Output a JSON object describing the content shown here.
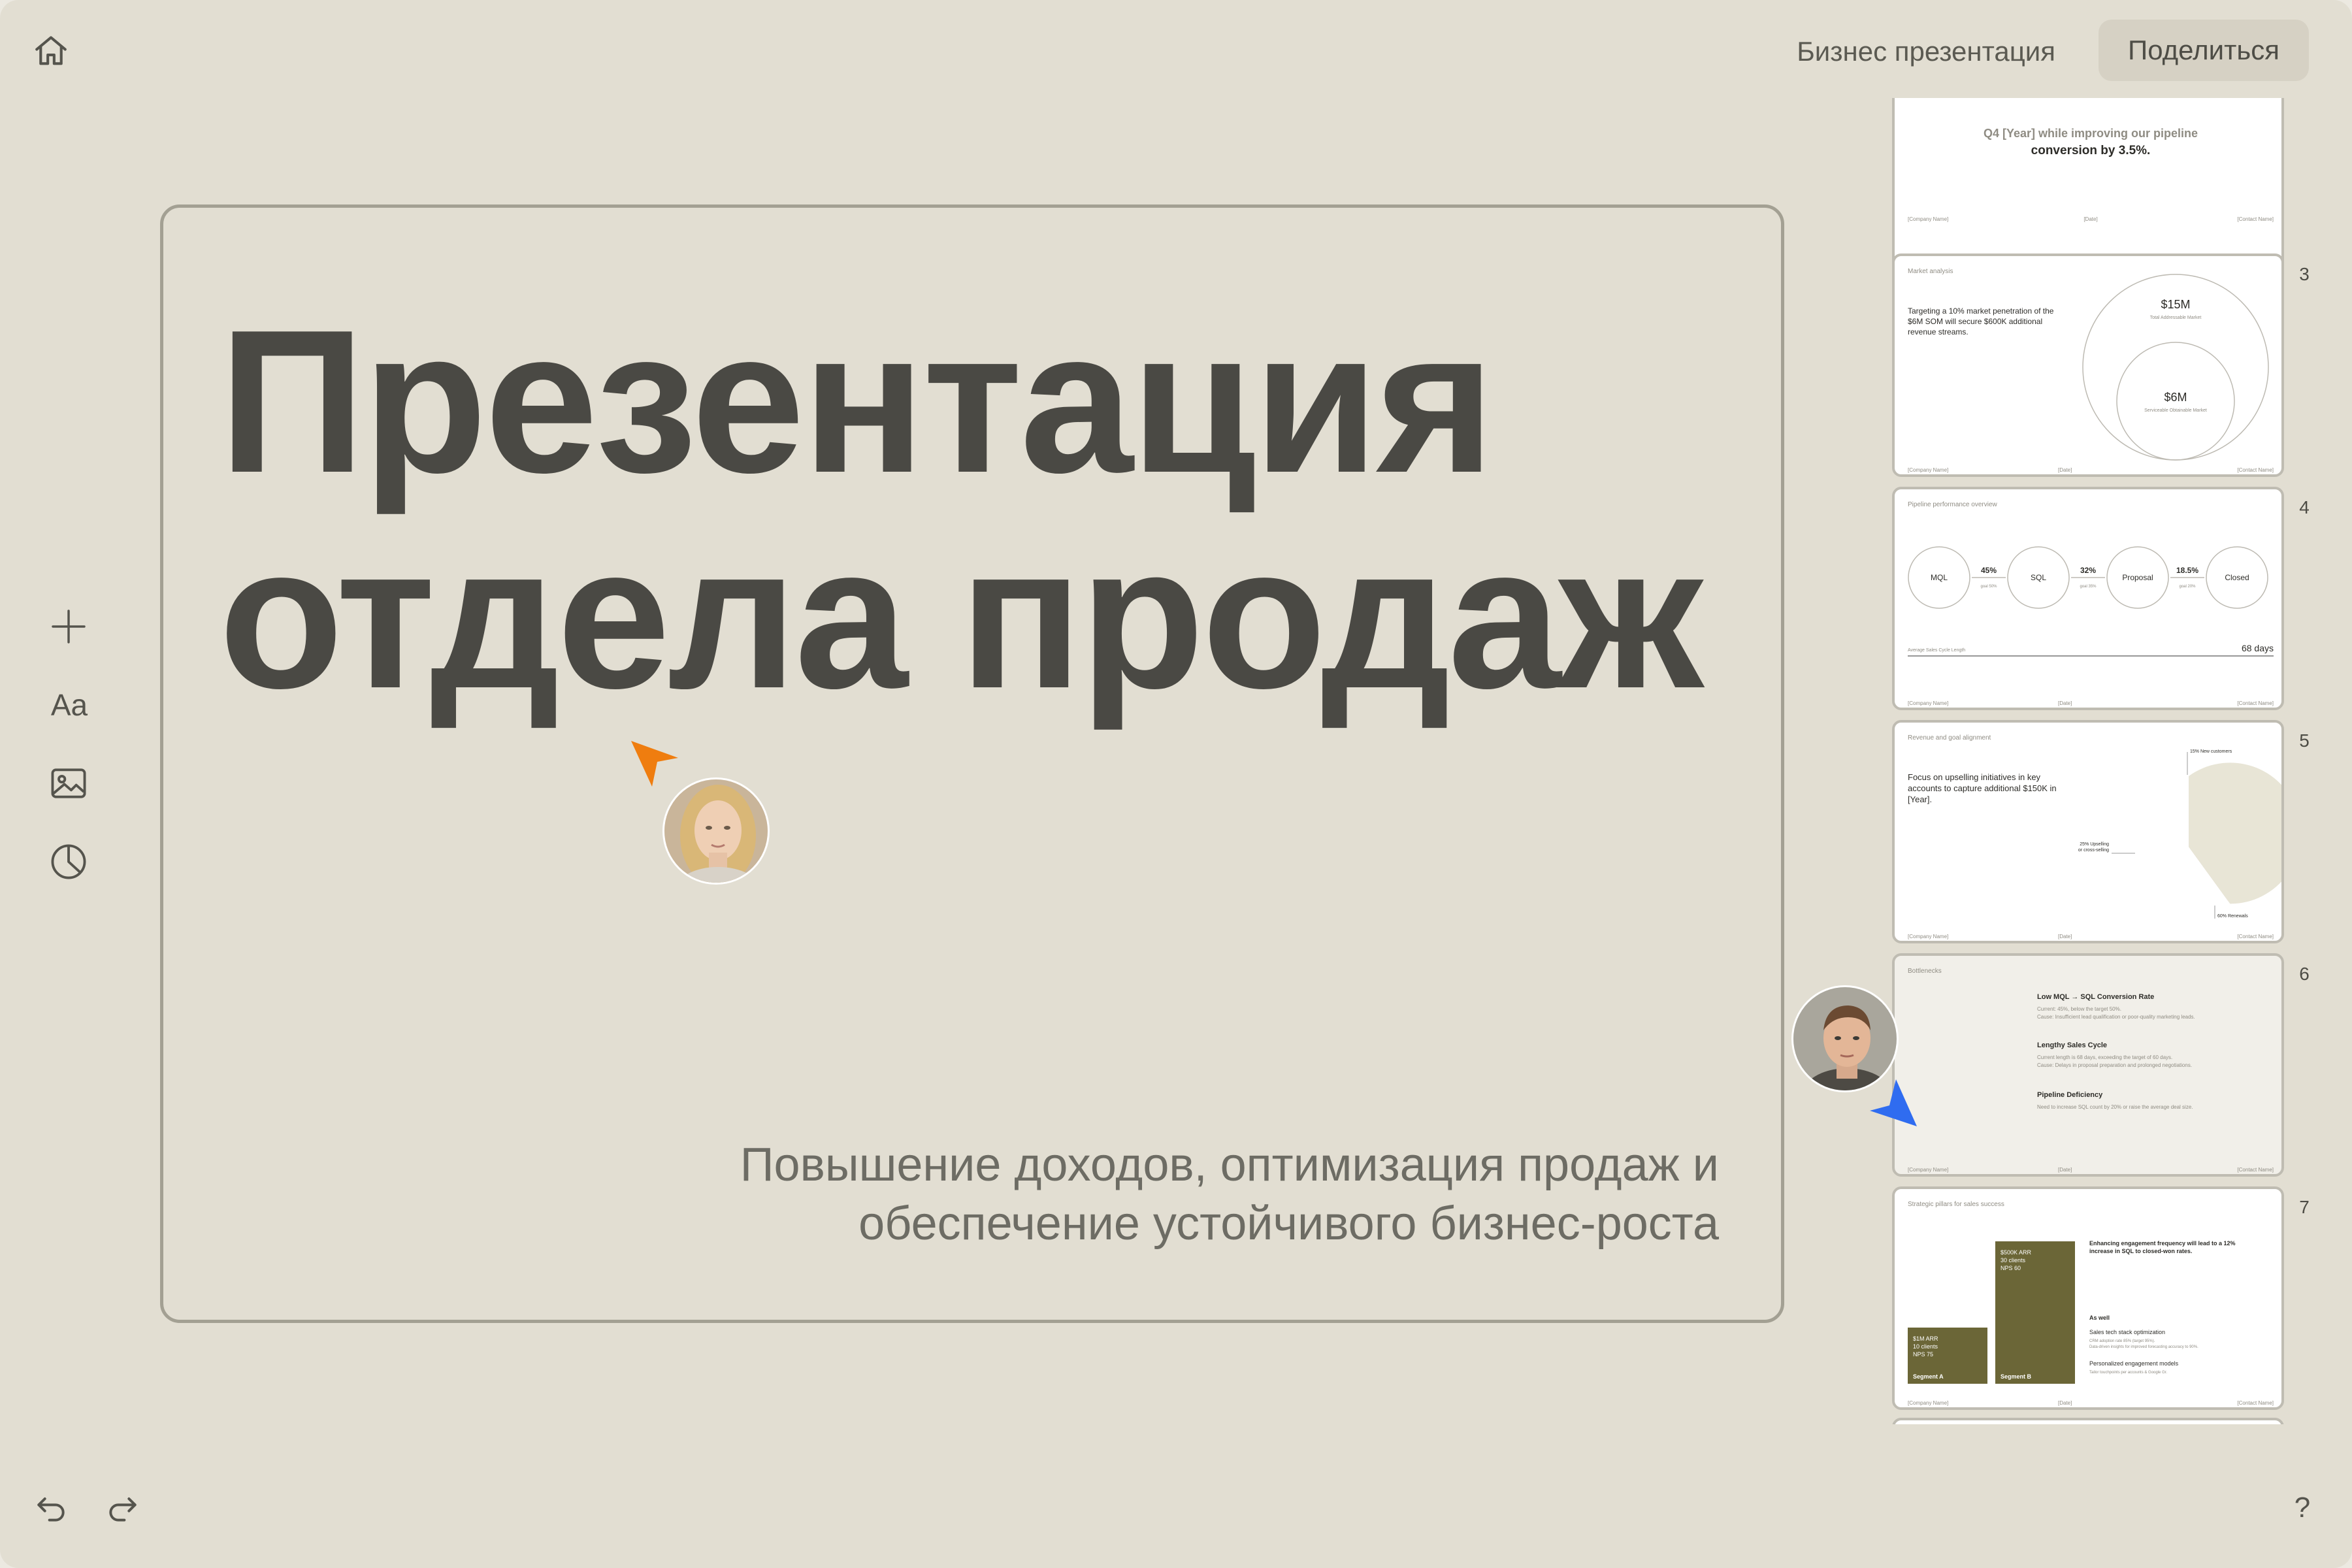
{
  "header": {
    "doc_title": "Бизнес презентация",
    "share_label": "Поделиться"
  },
  "icons": {
    "home": "home-icon",
    "add": "plus-icon",
    "text_tool": "Aa",
    "image": "image-icon",
    "chart": "pie-chart-icon",
    "undo": "undo-icon",
    "redo": "redo-icon",
    "help": "?"
  },
  "main_slide": {
    "title_line1": "Презентация",
    "title_line2": "отдела продаж",
    "subtitle_line1": "Повышение доходов, оптимизация продаж и",
    "subtitle_line2": "обеспечение устойчивого бизнес-роста"
  },
  "colors": {
    "cursor_a": "#ef7d0f",
    "cursor_b": "#2f6cf0",
    "bar": "#6b6637",
    "pie_a": "#c4a372",
    "pie_b": "#cdc4b5",
    "pie_c": "#e8e5d6"
  },
  "thumbnails": [
    {
      "number": "",
      "text1": "Q4 [Year] while improving our pipeline",
      "text2": "conversion by 3.5%.",
      "footer_left": "[Company Name]",
      "footer_mid": "[Date]",
      "footer_right": "[Contact Name]"
    },
    {
      "number": "3",
      "header": "Market analysis",
      "body1": "Targeting a 10% market penetration of the",
      "body2": "$6M SOM will secure $600K additional",
      "body3": "revenue streams.",
      "big_value": "$15M",
      "big_label": "Total Addressable Market",
      "small_value": "$6M",
      "small_label": "Serviceable Obtainable Market",
      "footer_left": "[Company Name]",
      "footer_mid": "[Date]",
      "footer_right": "[Contact Name]"
    },
    {
      "number": "4",
      "header": "Pipeline performance overview",
      "stages": [
        {
          "label": "MQL"
        },
        {
          "label": "SQL"
        },
        {
          "label": "Proposal"
        },
        {
          "label": "Closed"
        }
      ],
      "conversions": [
        {
          "pct": "45%",
          "goal": "goal 50%"
        },
        {
          "pct": "32%",
          "goal": "goal 35%"
        },
        {
          "pct": "18.5%",
          "goal": "goal 20%"
        }
      ],
      "cycle_label": "Average Sales Cycle Length",
      "cycle_value": "68 days",
      "footer_left": "[Company Name]",
      "footer_mid": "[Date]",
      "footer_right": "[Contact Name]"
    },
    {
      "number": "5",
      "header": "Revenue and goal alignment",
      "body1": "Focus on upselling initiatives in key",
      "body2": "accounts to capture additional $150K in",
      "body3": "[Year].",
      "pie_label_a": "15% New customers",
      "pie_label_b1": "25% Upselling",
      "pie_label_b2": "or cross-selling",
      "pie_label_c": "60% Renewals",
      "pie_values": [
        15,
        25,
        60
      ],
      "footer_left": "[Company Name]",
      "footer_mid": "[Date]",
      "footer_right": "[Contact Name]"
    },
    {
      "number": "6",
      "header": "Bottlenecks",
      "item1_title": "Low MQL → SQL Conversion Rate",
      "item1_l1": "Current: 45%, below the target 50%.",
      "item1_l2": "Cause: Insufficient lead qualification or poor-quality marketing leads.",
      "item2_title": "Lengthy Sales Cycle",
      "item2_l1": "Current length is 68 days, exceeding the target of 60 days.",
      "item2_l2": "Cause: Delays in proposal preparation and prolonged negotiations.",
      "item3_title": "Pipeline Deficiency",
      "item3_l1": "Need to increase SQL count by 20% or raise the average deal size.",
      "footer_left": "[Company Name]",
      "footer_mid": "[Date]",
      "footer_right": "[Contact Name]"
    },
    {
      "number": "7",
      "header": "Strategic pillars for sales success",
      "seg_a_l1": "$1M ARR",
      "seg_a_l2": "10 clients",
      "seg_a_l3": "NPS 75",
      "seg_a_name": "Segment A",
      "seg_b_l1": "$500K ARR",
      "seg_b_l2": "30 clients",
      "seg_b_l3": "NPS 60",
      "seg_b_name": "Segment B",
      "right_title1": "Enhancing engagement frequency will lead to a 12%",
      "right_title2": "increase in SQL to closed-won rates.",
      "as_well": "As well",
      "opt1": "Sales tech stack optimization",
      "opt1_d1": "CRM adoption rate 85% (target 95%).",
      "opt1_d2": "Data-driven insights for improved forecasting accuracy to 90%.",
      "opt2": "Personalized engagement models",
      "opt2_d1": "Tailor touchpoints per accounts & Google Gr.",
      "footer_left": "[Company Name]",
      "footer_mid": "[Date]",
      "footer_right": "[Contact Name]"
    }
  ]
}
